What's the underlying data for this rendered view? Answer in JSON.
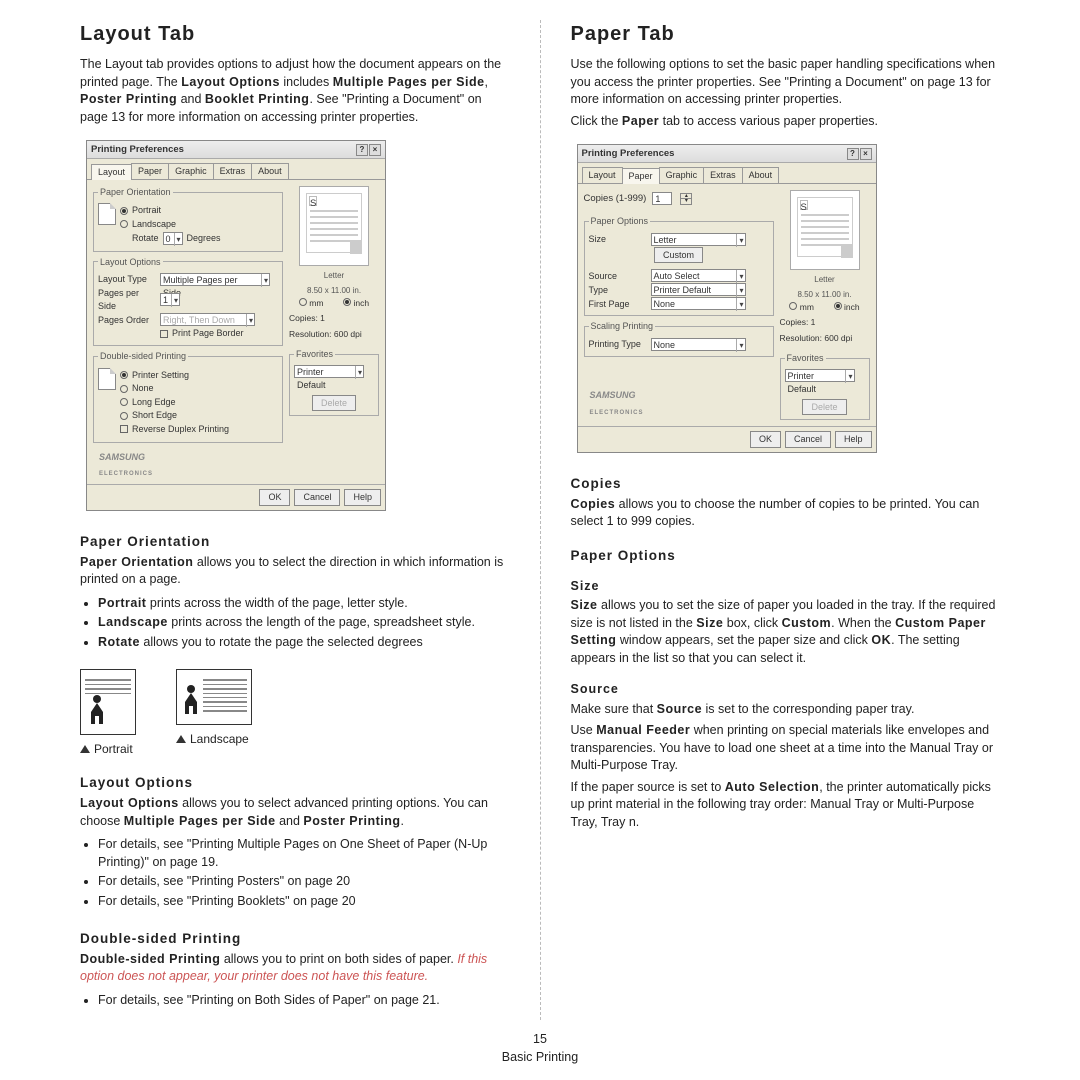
{
  "page_number": "15",
  "page_footer": "Basic Printing",
  "left": {
    "heading": "Layout Tab",
    "intro_a": "The Layout tab provides options to adjust how the document appears on the printed page. The ",
    "intro_b": "Layout Options",
    "intro_c": " includes ",
    "intro_d": "Multiple Pages per Side",
    "intro_e": ", ",
    "intro_f": "Poster Printing",
    "intro_g": " and ",
    "intro_h": "Booklet Printing",
    "intro_i": ". See \"Printing a Document\" on page 13 for more information on accessing printer properties.",
    "section1_h": "Paper Orientation",
    "section1_lead_b": "Paper Orientation",
    "section1_lead": " allows you to select the direction in which information is printed on a page.",
    "section1_b1_b": "Portrait",
    "section1_b1": " prints across the width of the page, letter style.",
    "section1_b2_b": "Landscape",
    "section1_b2": " prints across the length of the page, spreadsheet style.",
    "section1_b3_b": "Rotate",
    "section1_b3": " allows you to rotate the page the selected degrees",
    "or_portrait": "Portrait",
    "or_landscape": "Landscape",
    "section2_h": "Layout Options",
    "section2_lead_b": "Layout Options",
    "section2_lead": " allows you to select advanced printing options. You can choose ",
    "section2_lead_b2": "Multiple Pages per Side",
    "section2_lead2": " and ",
    "section2_lead_b3": "Poster Printing",
    "section2_lead3": ".",
    "section2_b1": "For details, see \"Printing Multiple Pages on One Sheet of Paper (N-Up Printing)\" on page 19.",
    "section2_b2": "For details, see \"Printing Posters\" on page 20",
    "section2_b3": "For details, see \"Printing Booklets\" on page 20",
    "section3_h": "Double-sided Printing",
    "section3_lead_b": "Double-sided Printing",
    "section3_lead": " allows you to print on both sides of paper. ",
    "section3_note": "If this option does not appear, your printer does not have this feature.",
    "section3_b1": "For details, see \"Printing on Both Sides of Paper\" on page 21."
  },
  "right": {
    "heading": "Paper Tab",
    "intro": "Use the following options to set the basic paper handling specifications when you access the printer properties. See \"Printing a Document\" on page 13 for more information on accessing printer properties.",
    "click_line_a": "Click the ",
    "click_line_b": "Paper",
    "click_line_c": " tab to access various paper properties.",
    "sec1_h": "Copies",
    "sec1_lead_b": "Copies",
    "sec1_lead": " allows you to choose the number of copies to be printed. You can select 1 to 999 copies.",
    "sec2_h": "Paper Options",
    "sec3_h": "Size",
    "sec3_txt_a_b": "Size",
    "sec3_txt_a": " allows you to set the size of paper you loaded in the tray. If the required size is not listed in the ",
    "sec3_txt_b_b": "Size",
    "sec3_txt_b": " box, click ",
    "sec3_txt_c_b": "Custom",
    "sec3_txt_c": ". When the ",
    "sec3_txt_d_b": "Custom Paper Setting",
    "sec3_txt_d": " window appears, set the paper size and click ",
    "sec3_txt_e_b": "OK",
    "sec3_txt_e": ". The setting appears in the list so that you can select it.",
    "sec4_h": "Source",
    "sec4_p1_a": "Make sure that ",
    "sec4_p1_b_b": "Source",
    "sec4_p1_b": " is set to the corresponding paper tray.",
    "sec4_p2_a": "Use ",
    "sec4_p2_b_b": "Manual Feeder",
    "sec4_p2_b": " when printing on special materials like envelopes and transparencies. You have to load one sheet at a time into the Manual Tray or Multi-Purpose Tray.",
    "sec4_p3_a": "If the paper source is set to ",
    "sec4_p3_b_b": "Auto Selection",
    "sec4_p3_b": ", the printer automatically picks up print material in the following tray order: Manual Tray or Multi-Purpose Tray, Tray n."
  },
  "dlg": {
    "title": "Printing Preferences",
    "tabs": [
      "Layout",
      "Paper",
      "Graphic",
      "Extras",
      "About"
    ],
    "fs_orient": "Paper Orientation",
    "portrait": "Portrait",
    "landscape": "Landscape",
    "rotate": "Rotate",
    "rotate_val": "0",
    "degrees": "Degrees",
    "fs_layout": "Layout Options",
    "layout_type": "Layout Type",
    "layout_type_val": "Multiple Pages per Side",
    "pps": "Pages per Side",
    "pps_val": "1",
    "page_order": "Pages Order",
    "page_order_val": "Right, Then Down",
    "print_border": "Print Page Border",
    "fs_dsp": "Double-sided Printing",
    "dsp_printer": "Printer Setting",
    "dsp_none": "None",
    "dsp_long": "Long Edge",
    "dsp_short": "Short Edge",
    "dsp_rev": "Reverse Duplex Printing",
    "samsung": "SAMSUNG",
    "electronics": "ELECTRONICS",
    "prev_paper": "Letter",
    "prev_dim": "8.50 x 11.00 in.",
    "unit_mm": "mm",
    "unit_inch": "inch",
    "copies": "Copies: 1",
    "resolution": "Resolution: 600 dpi",
    "favorites": "Favorites",
    "fav_val": "Printer Default",
    "delete": "Delete",
    "ok": "OK",
    "cancel": "Cancel",
    "help": "Help",
    "copies_label": "Copies (1-999)",
    "copies_val": "1",
    "fs_paperopt": "Paper Options",
    "size": "Size",
    "size_val": "Letter",
    "custom": "Custom",
    "source": "Source",
    "source_val": "Auto Select",
    "type": "Type",
    "type_val": "Printer Default",
    "first": "First Page",
    "first_val": "None",
    "fs_scaling": "Scaling Printing",
    "ptype": "Printing Type",
    "ptype_val": "None"
  }
}
